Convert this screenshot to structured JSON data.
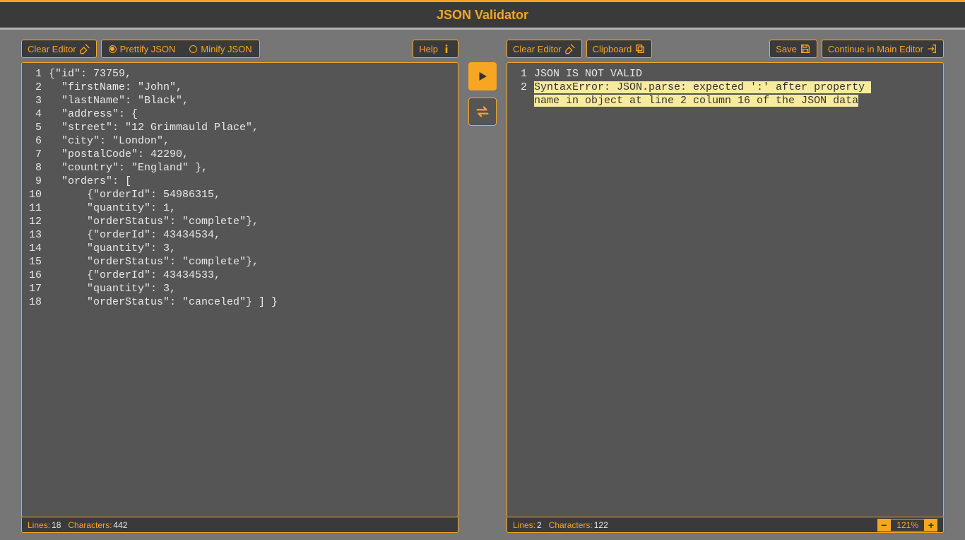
{
  "header": {
    "title": "JSON Validator"
  },
  "left": {
    "toolbar": {
      "clear": "Clear Editor",
      "prettify": "Prettify JSON",
      "minify": "Minify JSON",
      "help": "Help"
    },
    "code_lines": [
      "{\"id\": 73759,",
      "  \"firstName: \"John\",",
      "  \"lastName\": \"Black\",",
      "  \"address\": {",
      "  \"street\": \"12 Grimmauld Place\",",
      "  \"city\": \"London\",",
      "  \"postalCode\": 42290,",
      "  \"country\": \"England\" },",
      "  \"orders\": [",
      "      {\"orderId\": 54986315,",
      "      \"quantity\": 1,",
      "      \"orderStatus\": \"complete\"},",
      "      {\"orderId\": 43434534,",
      "      \"quantity\": 3,",
      "      \"orderStatus\": \"complete\"},",
      "      {\"orderId\": 43434533,",
      "      \"quantity\": 3,",
      "      \"orderStatus\": \"canceled\"} ] }"
    ],
    "status": {
      "lines_label": "Lines:",
      "lines": "18",
      "chars_label": "Characters:",
      "chars": "442"
    }
  },
  "right": {
    "toolbar": {
      "clear": "Clear Editor",
      "clipboard": "Clipboard",
      "save": "Save",
      "continue": "Continue in Main Editor"
    },
    "output": {
      "line1": "JSON IS NOT VALID",
      "line2a": "SyntaxError: JSON.parse: expected ':' after property ",
      "line2b": "name in object at line 2 column 16 of the JSON data"
    },
    "status": {
      "lines_label": "Lines:",
      "lines": "2",
      "chars_label": "Characters:",
      "chars": "122",
      "zoom": "121%"
    }
  }
}
